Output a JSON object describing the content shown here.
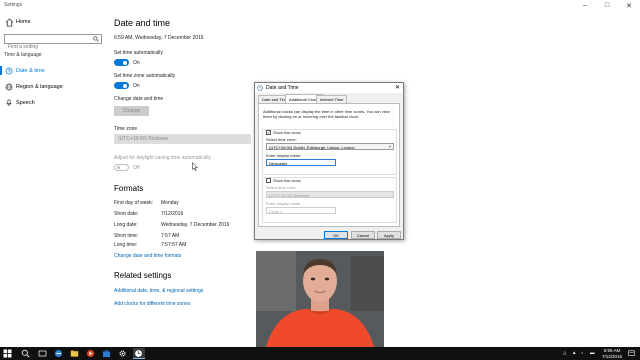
{
  "window": {
    "title": "Settings"
  },
  "sidebar": {
    "home": "Home",
    "search_placeholder": "Find a setting",
    "group": "Time & language",
    "items": [
      {
        "label": "Date & time",
        "icon": "clock-icon",
        "active": true
      },
      {
        "label": "Region & language",
        "icon": "globe-icon",
        "active": false
      },
      {
        "label": "Speech",
        "icon": "microphone-icon",
        "active": false
      }
    ]
  },
  "main": {
    "title": "Date and time",
    "current": "6:59 AM, Wednesday, 7 December 2016",
    "set_time_auto": {
      "label": "Set time automatically",
      "state": "On"
    },
    "set_zone_auto": {
      "label": "Set time zone automatically",
      "state": "On"
    },
    "change_label": "Change date and time",
    "change_button": "Change",
    "tz_label": "Time zone",
    "tz_value": "(UTC+10:00) Brisbane",
    "dst": {
      "label": "Adjust for daylight saving time automatically",
      "state": "Off"
    },
    "formats": {
      "title": "Formats",
      "rows": [
        {
          "k": "First day of week:",
          "v": "Monday"
        },
        {
          "k": "Short date:",
          "v": "7/12/2016"
        },
        {
          "k": "Long date:",
          "v": "Wednesday, 7 December 2016"
        },
        {
          "k": "Short time:",
          "v": "7:57 AM"
        },
        {
          "k": "Long time:",
          "v": "7:57:57 AM"
        }
      ],
      "link": "Change date and time formats"
    },
    "related": {
      "title": "Related settings",
      "links": [
        "Additional date, time, & regional settings",
        "Add clocks for different time zones"
      ]
    }
  },
  "dialog": {
    "title": "Date and Time",
    "tabs": [
      "Date and Time",
      "Additional Clocks",
      "Internet Time"
    ],
    "description": "Additional clocks can display the time in other time zones. You can view them by clicking on or hovering over the taskbar clock.",
    "clock1": {
      "show": "Show this clock",
      "checked": true,
      "zone_label": "Select time zone:",
      "zone": "(UTC+00:00) Dublin, Edinburgh, Lisbon, London",
      "name_label": "Enter display name:",
      "name": "Newcastle"
    },
    "clock2": {
      "show": "Show this clock",
      "checked": false,
      "zone_label": "Select time zone:",
      "zone": "(UTC+10:00) Brisbane",
      "name_label": "Enter display name:",
      "name": "Clock 2"
    },
    "buttons": {
      "ok": "OK",
      "cancel": "Cancel",
      "apply": "Apply"
    }
  },
  "taskbar": {
    "time": "6:59 AM",
    "date": "7/12/2016"
  },
  "colors": {
    "accent": "#0078d7",
    "link": "#0066b4",
    "taskbar": "#101010"
  }
}
